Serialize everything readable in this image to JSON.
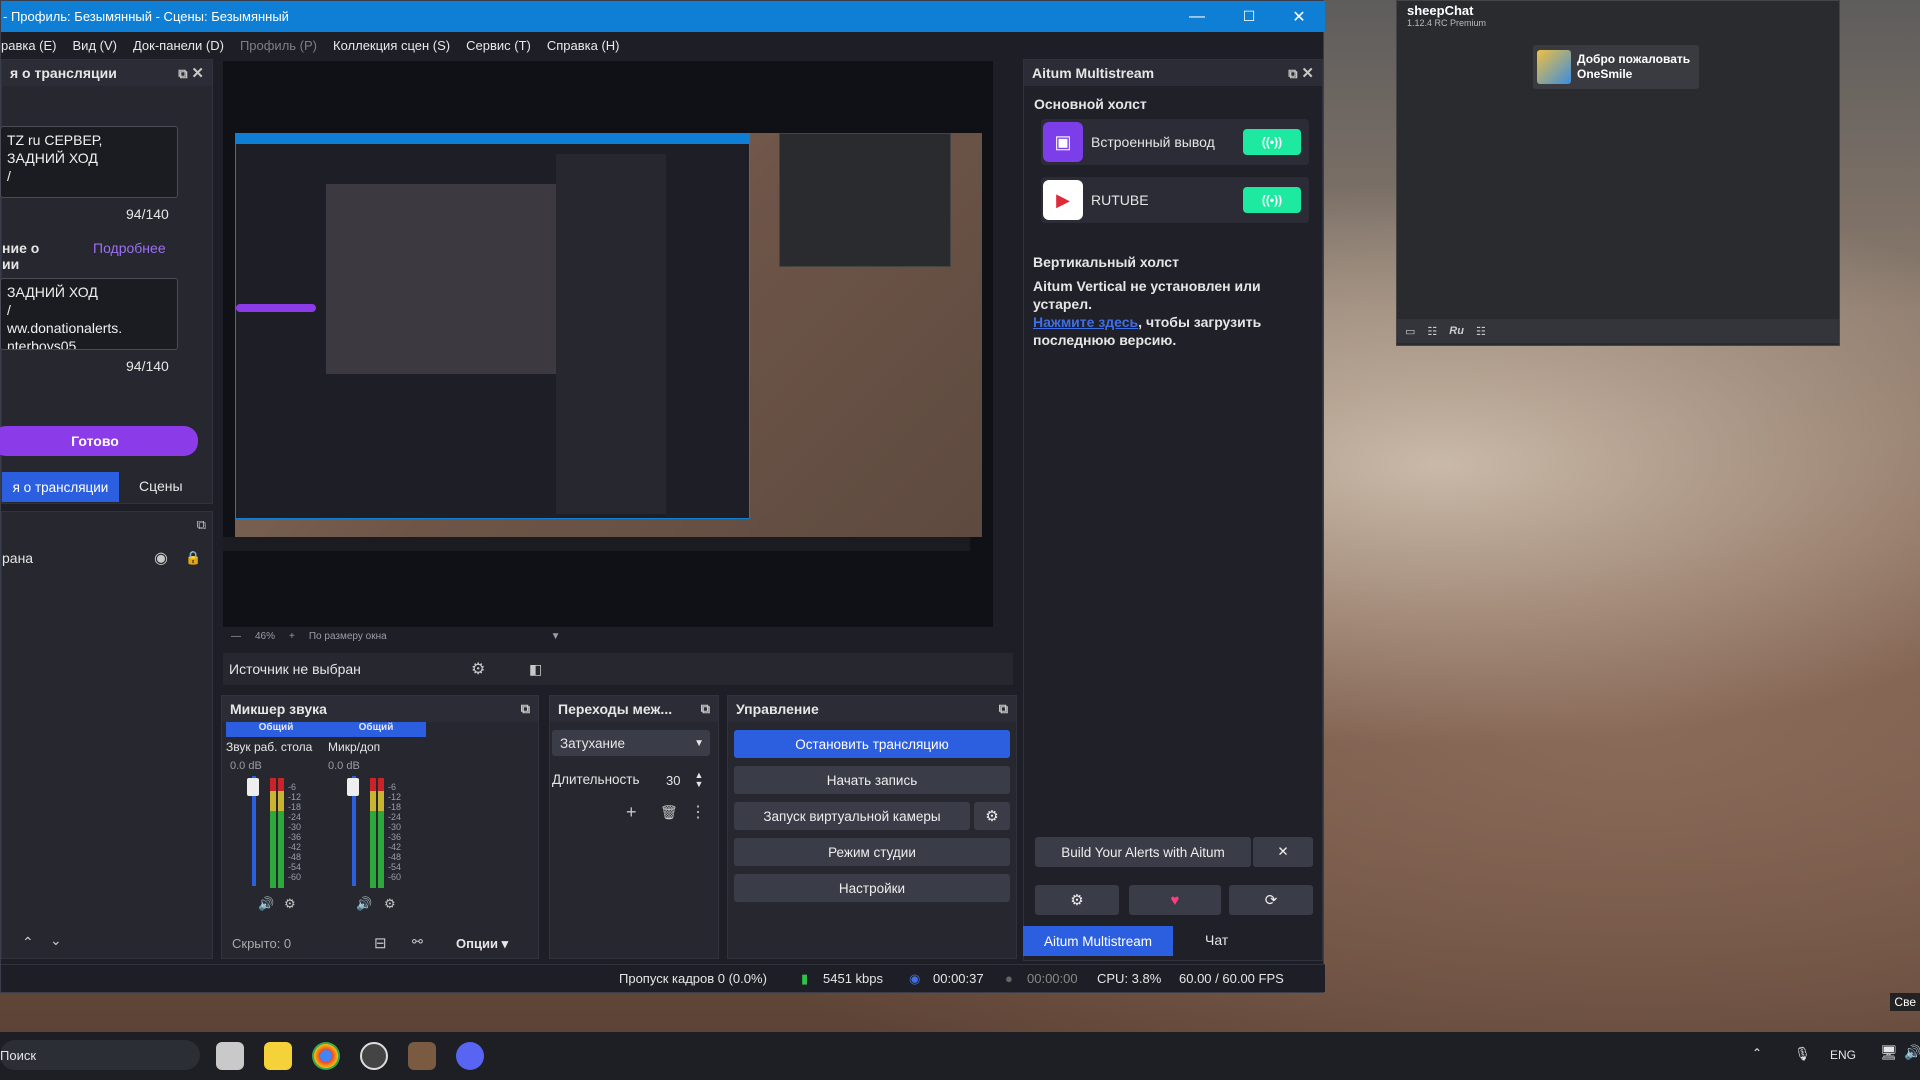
{
  "window": {
    "title": "- Профиль: Безымянный - Сцены: Безымянный",
    "minimize": "—",
    "maximize": "☐",
    "close": "✕"
  },
  "menu": [
    "равка (E)",
    "Вид (V)",
    "Док-панели (D)",
    "Профиль (P)",
    "Коллекция сцен (S)",
    "Сервис (T)",
    "Справка (H)"
  ],
  "stream_info": {
    "title": "я о трансляции",
    "title_text": "TZ ru СЕРВЕР,\nЗАДНИЙ ХОД\n/",
    "title_count": "94/140",
    "desc_label": "ние о\nии",
    "more": "Подробнее",
    "desc_text": "ЗАДНИЙ ХОД\n/\nww.donationalerts.\nnterboys05",
    "desc_count": "94/140",
    "done": "Готово",
    "tab_info": "я о трансляции",
    "tab_scenes": "Сцены"
  },
  "sources": {
    "item": "рана"
  },
  "preview_bar": {
    "zoom": "46%",
    "fit": "По размеру окна"
  },
  "source_bar": {
    "label": "Источник не выбран"
  },
  "mixer": {
    "title": "Микшер звука",
    "ch1": {
      "group": "Общий",
      "name": "Звук раб. стола",
      "db": "0.0 dB"
    },
    "ch2": {
      "group": "Общий",
      "name": "Микр/доп",
      "db": "0.0 dB"
    },
    "scale": [
      "-6",
      "-12",
      "-18",
      "-24",
      "-30",
      "-36",
      "-42",
      "-48",
      "-54",
      "-60"
    ],
    "hidden": "Скрыто: 0",
    "options": "Опции"
  },
  "transitions": {
    "title": "Переходы меж...",
    "type": "Затухание",
    "duration_label": "Длительность",
    "duration": "30"
  },
  "controls": {
    "title": "Управление",
    "stop": "Остановить трансляцию",
    "record": "Начать запись",
    "vcam": "Запуск виртуальной камеры",
    "studio": "Режим студии",
    "settings": "Настройки"
  },
  "aitum": {
    "title": "Aitum Multistream",
    "main_canvas": "Основной холст",
    "builtin": "Встроенный вывод",
    "rutube": "RUTUBE",
    "vertical": "Вертикальный холст",
    "notice1": "Aitum Vertical не установлен или устарел.",
    "link": "Нажмите здесь",
    "notice2": ", чтобы загрузить последнюю версию.",
    "alerts": "Build Your Alerts with Aitum",
    "tab_aitum": "Aitum Multistream",
    "tab_chat": "Чат"
  },
  "status": {
    "dropped": "Пропуск кадров 0 (0.0%)",
    "kbps": "5451 kbps",
    "stream_time": "00:00:37",
    "rec_time": "00:00:00",
    "cpu": "CPU: 3.8%",
    "fps": "60.00 / 60.00 FPS"
  },
  "sheepchat": {
    "title": "sheepChat",
    "version": "1.12.4 RC Premium",
    "welcome1": "Добро пожаловать",
    "welcome2": "OneSmile",
    "lang": "Ru"
  },
  "taskbar": {
    "search": "Поиск",
    "lang": "ENG"
  },
  "corner": "Све"
}
